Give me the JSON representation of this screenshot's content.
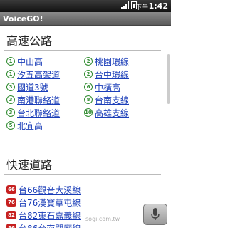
{
  "status_bar": {
    "ampm": "下午",
    "time": "1:42"
  },
  "app_title": "VoiceGO!",
  "sections": {
    "highway": {
      "title": "高速公路",
      "roads": [
        {
          "num": "1",
          "name": "中山高"
        },
        {
          "num": "2",
          "name": "桃園環線"
        },
        {
          "num": "1",
          "name": "汐五高架道"
        },
        {
          "num": "2",
          "name": "台中環線"
        },
        {
          "num": "3",
          "name": "國道3號"
        },
        {
          "num": "6",
          "name": "中橫高"
        },
        {
          "num": "3",
          "name": "南港聯絡道"
        },
        {
          "num": "8",
          "name": "台南支線"
        },
        {
          "num": "3",
          "name": "台北聯絡道"
        },
        {
          "num": "10",
          "name": "高雄支線"
        },
        {
          "num": "5",
          "name": "北宜高"
        }
      ]
    },
    "expressway": {
      "title": "快速道路",
      "roads": [
        {
          "num": "66",
          "name": "台66觀音大溪線"
        },
        {
          "num": "76",
          "name": "台76漢寶草屯線"
        },
        {
          "num": "82",
          "name": "台82東石嘉義線"
        },
        {
          "num": "86",
          "name": "台86台南關廟線"
        }
      ]
    }
  },
  "watermark": "sogi.com.tw",
  "colors": {
    "link": "#1a3db8",
    "highway_shield": "#2e8a2e",
    "expressway_badge": "#c62020"
  },
  "icons": {
    "mic": "microphone-icon"
  }
}
